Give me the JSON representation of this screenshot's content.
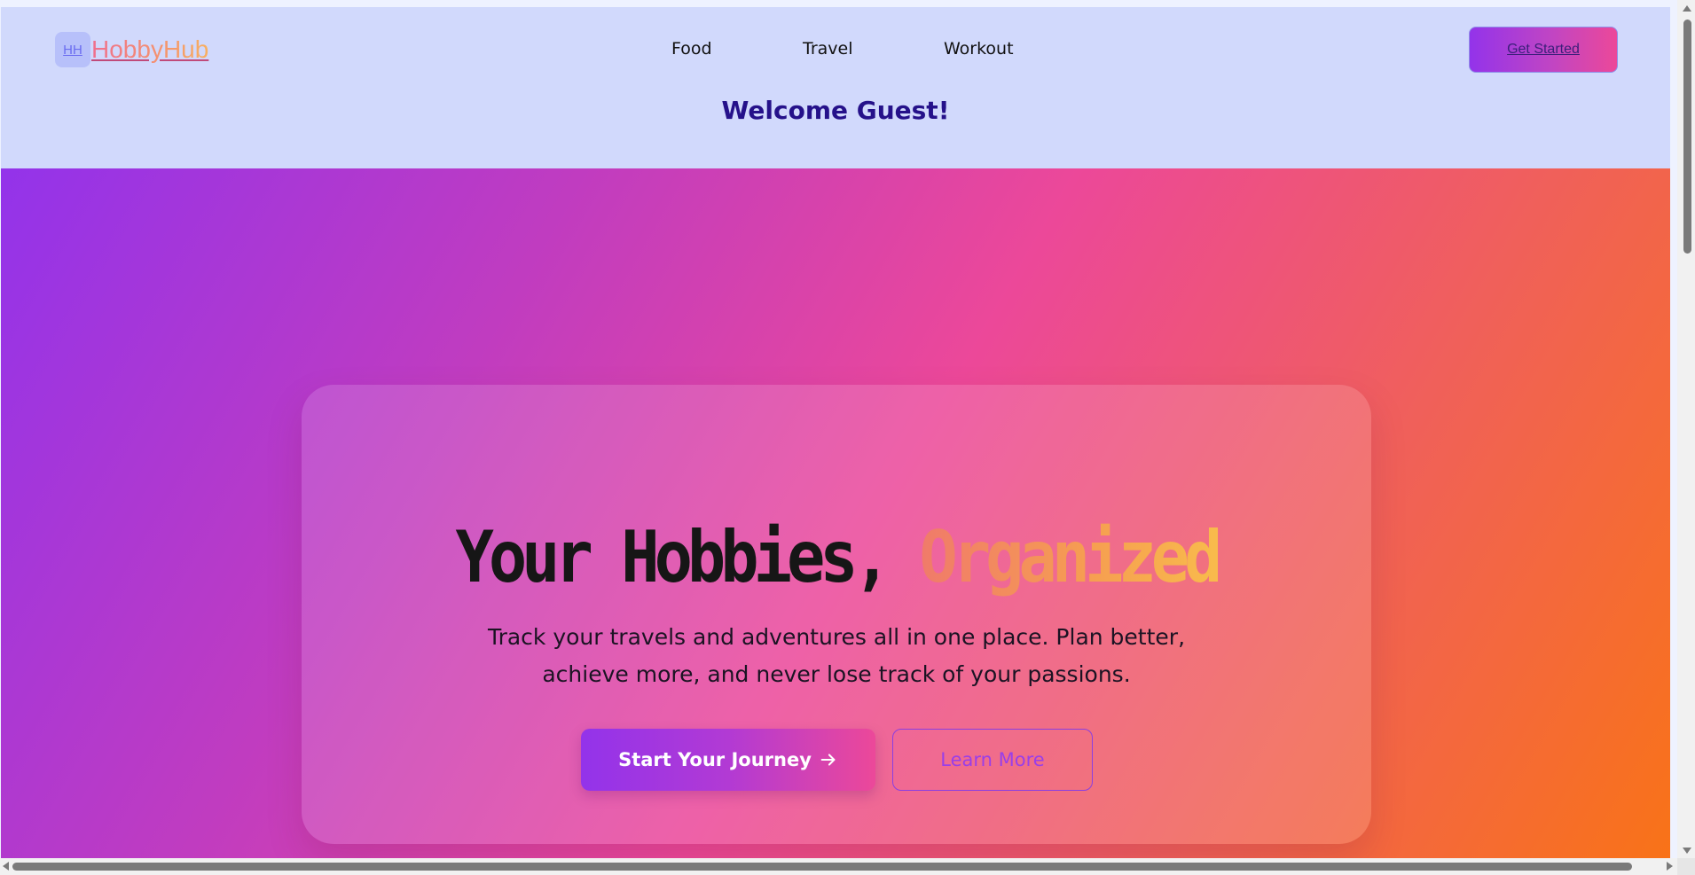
{
  "header": {
    "logo_badge": "HH",
    "logo_text": "HobbyHub",
    "nav": [
      {
        "label": "Food"
      },
      {
        "label": "Travel"
      },
      {
        "label": "Workout"
      }
    ],
    "cta_label": "Get Started",
    "welcome": "Welcome Guest!"
  },
  "hero": {
    "headline_main": "Your Hobbies, ",
    "headline_accent": "Organized",
    "subtitle": "Track your travels and adventures all in one place. Plan better, achieve more, and never lose track of your passions.",
    "primary_button": "Start Your Journey",
    "primary_button_icon": "arrow-right-icon",
    "secondary_button": "Learn More"
  },
  "colors": {
    "header_bg": "#d1d9fc",
    "welcome_text": "#25118a",
    "gradient_start": "#9333ea",
    "gradient_mid": "#ec4899",
    "gradient_end": "#f97316",
    "accent_text": "#f6a050"
  }
}
